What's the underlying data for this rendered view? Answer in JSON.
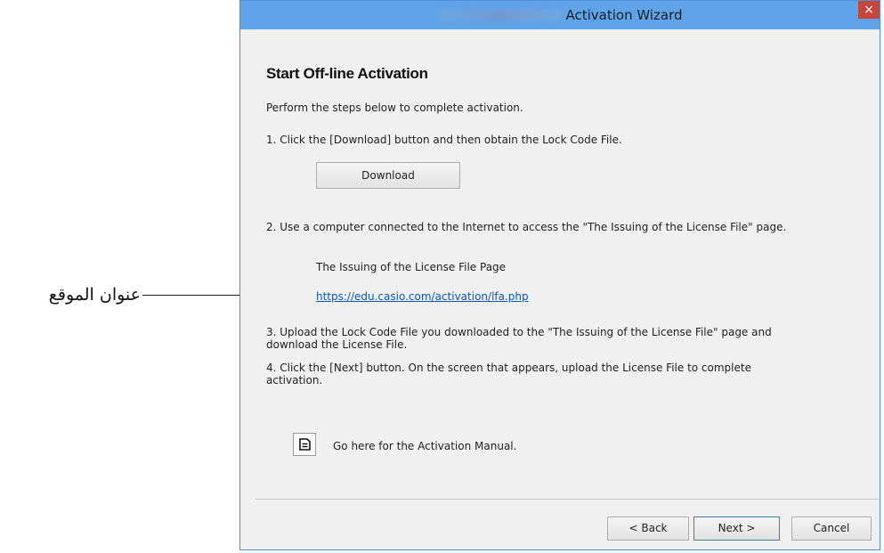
{
  "annotation": {
    "label": "عنوان الموقع"
  },
  "window": {
    "title": "Activation Wizard",
    "close_label": "×"
  },
  "content": {
    "heading": "Start Off-line Activation",
    "intro": "Perform the steps below to complete activation.",
    "step1": "1. Click the [Download] button and then obtain the Lock Code File.",
    "download_label": "Download",
    "step2": "2. Use a computer connected to the Internet to access the \"The Issuing of the License File\" page.",
    "license_page_title": "The Issuing of the License File Page",
    "license_url": "https://edu.casio.com/activation/lfa.php",
    "step3_line1": "3. Upload the Lock Code File you downloaded to the \"The Issuing of the License File\" page and",
    "step3_line2": "download the License File.",
    "step4_line1": "4. Click the [Next] button. On the screen that appears, upload the License File to complete",
    "step4_line2": "activation.",
    "manual_text": "Go here for the Activation Manual.",
    "manual_icon": "document-icon"
  },
  "footer": {
    "back_label": "< Back",
    "next_label": "Next >",
    "cancel_label": "Cancel"
  },
  "colors": {
    "titlebar": "#5fa3e8",
    "close": "#c7463c",
    "link": "#0b57b5",
    "background": "#f0f0f0"
  }
}
